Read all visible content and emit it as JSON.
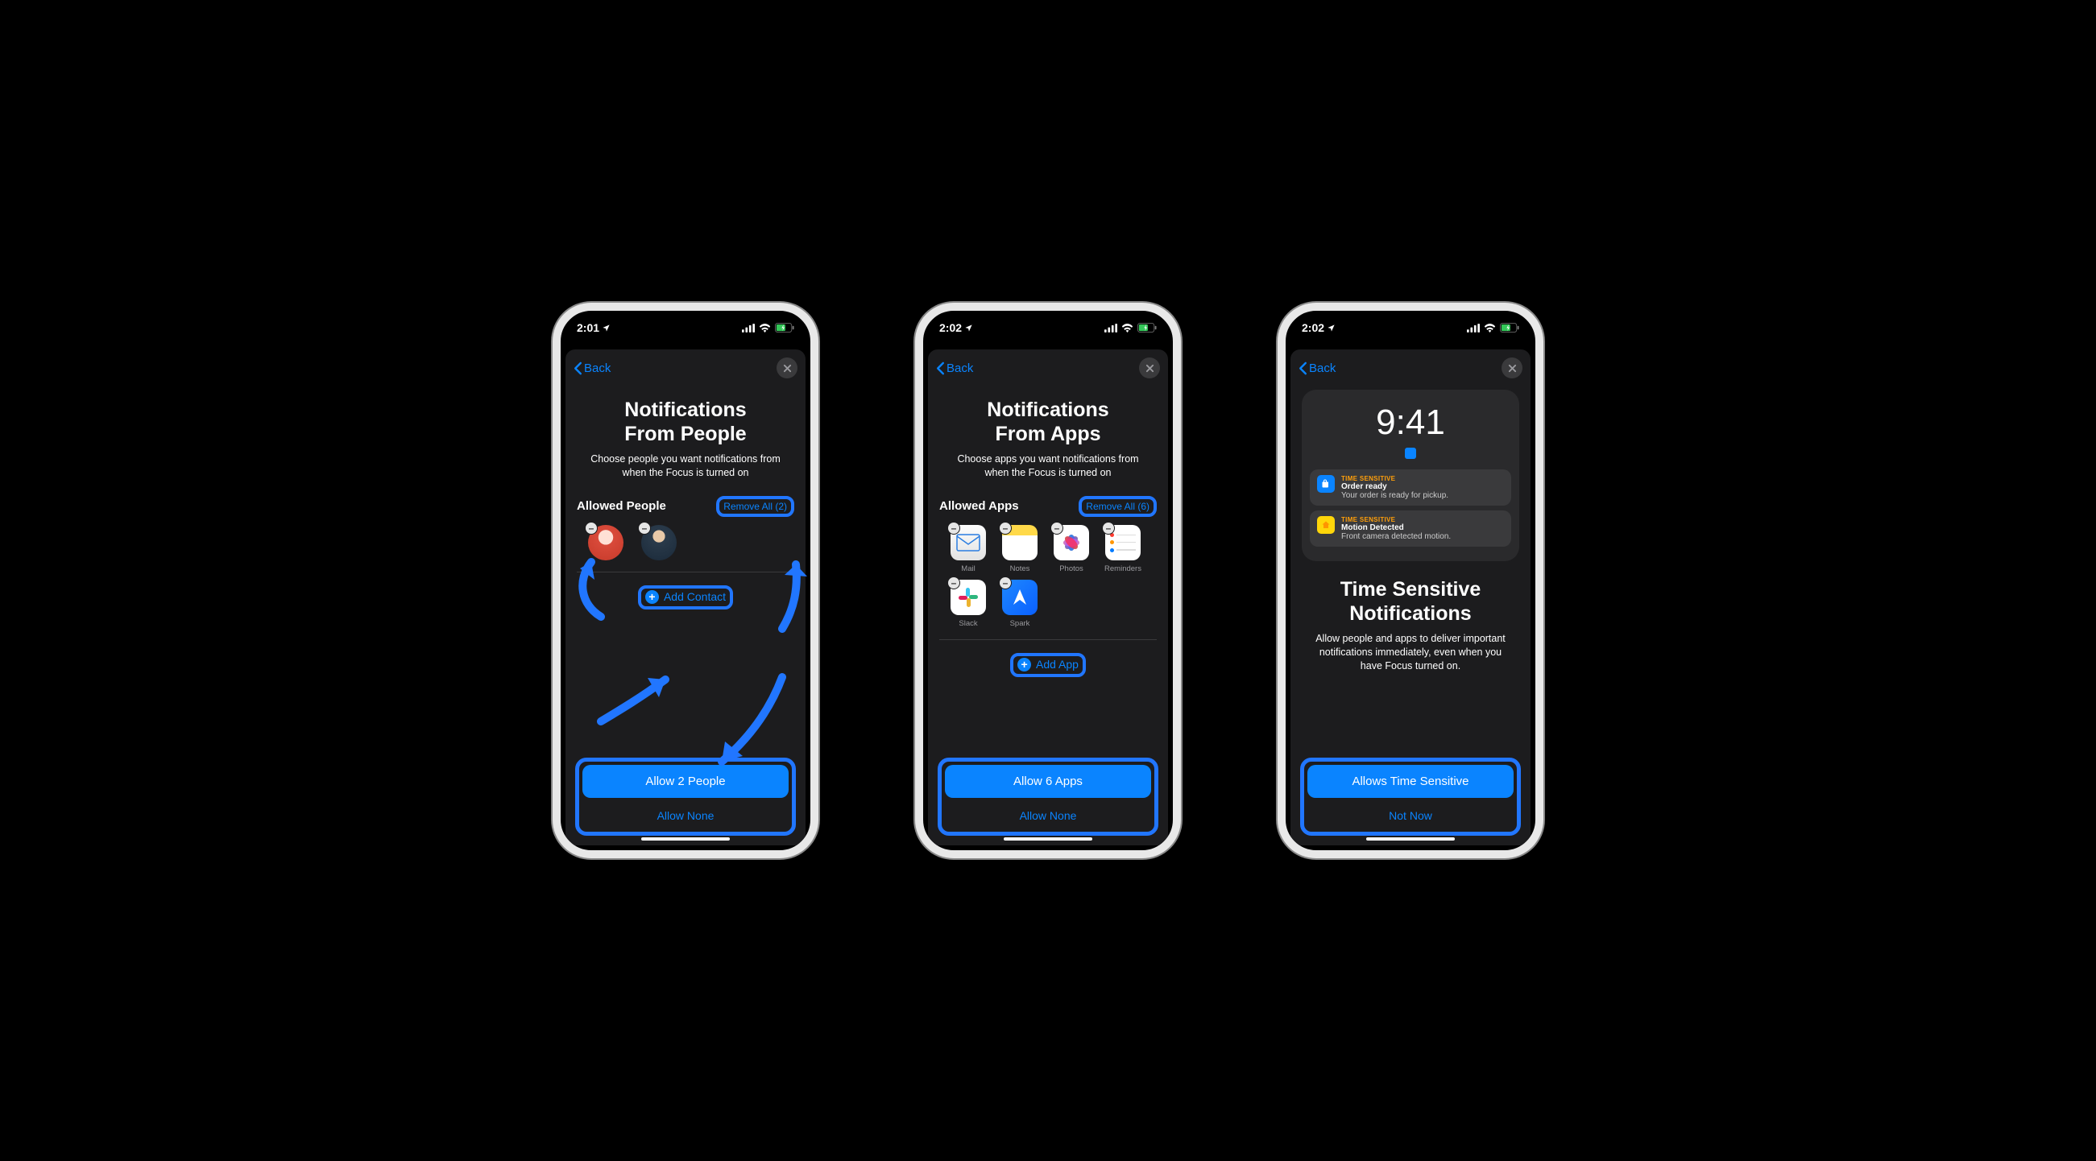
{
  "phones": [
    {
      "status_time": "2:01",
      "back_label": "Back",
      "title_line1": "Notifications",
      "title_line2": "From People",
      "subtitle": "Choose people you want notifications from when the Focus is turned on",
      "section_label": "Allowed People",
      "remove_all": "Remove All (2)",
      "add_label": "Add Contact",
      "primary": "Allow 2 People",
      "secondary": "Allow None"
    },
    {
      "status_time": "2:02",
      "back_label": "Back",
      "title_line1": "Notifications",
      "title_line2": "From Apps",
      "subtitle": "Choose apps you want notifications from when the Focus is turned on",
      "section_label": "Allowed Apps",
      "remove_all": "Remove All (6)",
      "apps": [
        "Mail",
        "Notes",
        "Photos",
        "Reminders",
        "Slack",
        "Spark"
      ],
      "add_label": "Add App",
      "primary": "Allow 6 Apps",
      "secondary": "Allow None"
    },
    {
      "status_time": "2:02",
      "back_label": "Back",
      "preview_time": "9:41",
      "notif1_tag": "TIME SENSITIVE",
      "notif1_title": "Order ready",
      "notif1_body": "Your order is ready for pickup.",
      "notif2_tag": "TIME SENSITIVE",
      "notif2_title": "Motion Detected",
      "notif2_body": "Front camera detected motion.",
      "title_line1": "Time Sensitive",
      "title_line2": "Notifications",
      "subtitle": "Allow people and apps to deliver important notifications immediately, even when you have Focus turned on.",
      "primary": "Allows Time Sensitive",
      "secondary": "Not Now"
    }
  ]
}
